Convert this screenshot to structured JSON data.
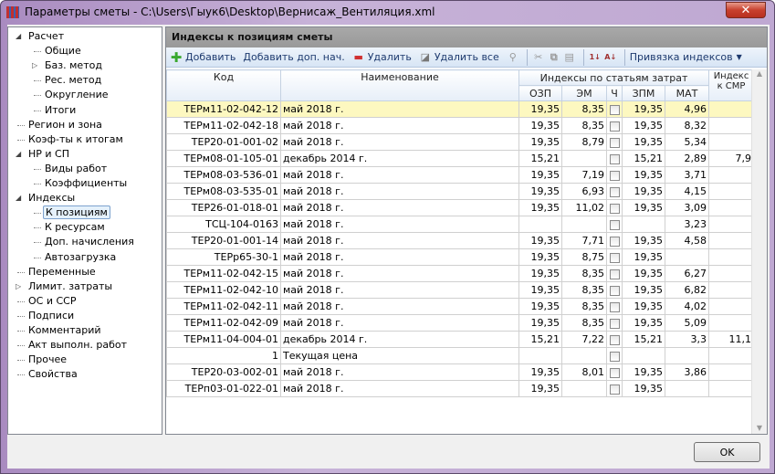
{
  "window": {
    "title": "Параметры сметы - C:\\Users\\Гыук6\\Desktop\\Вернисаж_Вентиляция.xml",
    "close": "✕"
  },
  "tree": [
    {
      "label": "Расчет",
      "level": 0,
      "expander": "expanded"
    },
    {
      "label": "Общие",
      "level": 1
    },
    {
      "label": "Баз. метод",
      "level": 1,
      "expander": "collapsed"
    },
    {
      "label": "Рес. метод",
      "level": 1
    },
    {
      "label": "Округление",
      "level": 1
    },
    {
      "label": "Итоги",
      "level": 1
    },
    {
      "label": "Регион и зона",
      "level": 0
    },
    {
      "label": "Коэф-ты к итогам",
      "level": 0
    },
    {
      "label": "НР и СП",
      "level": 0,
      "expander": "expanded"
    },
    {
      "label": "Виды работ",
      "level": 1
    },
    {
      "label": "Коэффициенты",
      "level": 1
    },
    {
      "label": "Индексы",
      "level": 0,
      "expander": "expanded"
    },
    {
      "label": "К позициям",
      "level": 1,
      "selected": true
    },
    {
      "label": "К ресурсам",
      "level": 1
    },
    {
      "label": "Доп. начисления",
      "level": 1
    },
    {
      "label": "Автозагрузка",
      "level": 1
    },
    {
      "label": "Переменные",
      "level": 0
    },
    {
      "label": "Лимит. затраты",
      "level": 0,
      "expander": "collapsed"
    },
    {
      "label": "ОС и ССР",
      "level": 0
    },
    {
      "label": "Подписи",
      "level": 0
    },
    {
      "label": "Комментарий",
      "level": 0
    },
    {
      "label": "Акт выполн. работ",
      "level": 0
    },
    {
      "label": "Прочее",
      "level": 0
    },
    {
      "label": "Свойства",
      "level": 0
    }
  ],
  "panel": {
    "title": "Индексы к позициям сметы"
  },
  "toolbar": {
    "add": "Добавить",
    "add_extra": "Добавить доп. нач.",
    "delete": "Удалить",
    "delete_all": "Удалить все",
    "binding": "Привязка индексов"
  },
  "table": {
    "headers": {
      "code": "Код",
      "name": "Наименование",
      "group": "Индексы по статьям затрат",
      "ozp": "ОЗП",
      "em": "ЭМ",
      "ch": "Ч",
      "zpm": "ЗПМ",
      "mat": "МАТ",
      "smr": "Индекс к СМР"
    },
    "rows": [
      [
        "ТЕРм11-02-042-12",
        "май 2018 г.",
        "19,35",
        "8,35",
        "19,35",
        "4,96",
        ""
      ],
      [
        "ТЕРм11-02-042-18",
        "май 2018 г.",
        "19,35",
        "8,35",
        "19,35",
        "8,32",
        ""
      ],
      [
        "ТЕР20-01-001-02",
        "май 2018 г.",
        "19,35",
        "8,79",
        "19,35",
        "5,34",
        ""
      ],
      [
        "ТЕРм08-01-105-01",
        "декабрь 2014 г.",
        "15,21",
        "",
        "15,21",
        "2,89",
        "7,9"
      ],
      [
        "ТЕРм08-03-536-01",
        "май 2018 г.",
        "19,35",
        "7,19",
        "19,35",
        "3,71",
        ""
      ],
      [
        "ТЕРм08-03-535-01",
        "май 2018 г.",
        "19,35",
        "6,93",
        "19,35",
        "4,15",
        ""
      ],
      [
        "ТЕР26-01-018-01",
        "май 2018 г.",
        "19,35",
        "11,02",
        "19,35",
        "3,09",
        ""
      ],
      [
        "ТСЦ-104-0163",
        "май 2018 г.",
        "",
        "",
        "",
        "3,23",
        ""
      ],
      [
        "ТЕР20-01-001-14",
        "май 2018 г.",
        "19,35",
        "7,71",
        "19,35",
        "4,58",
        ""
      ],
      [
        "ТЕРр65-30-1",
        "май 2018 г.",
        "19,35",
        "8,75",
        "19,35",
        "",
        ""
      ],
      [
        "ТЕРм11-02-042-15",
        "май 2018 г.",
        "19,35",
        "8,35",
        "19,35",
        "6,27",
        ""
      ],
      [
        "ТЕРм11-02-042-10",
        "май 2018 г.",
        "19,35",
        "8,35",
        "19,35",
        "6,82",
        ""
      ],
      [
        "ТЕРм11-02-042-11",
        "май 2018 г.",
        "19,35",
        "8,35",
        "19,35",
        "4,02",
        ""
      ],
      [
        "ТЕРм11-02-042-09",
        "май 2018 г.",
        "19,35",
        "8,35",
        "19,35",
        "5,09",
        ""
      ],
      [
        "ТЕРм11-04-004-01",
        "декабрь 2014 г.",
        "15,21",
        "7,22",
        "15,21",
        "3,3",
        "11,1"
      ],
      [
        "1",
        "Текущая цена",
        "",
        "",
        "",
        "",
        ""
      ],
      [
        "ТЕР20-03-002-01",
        "май 2018 г.",
        "19,35",
        "8,01",
        "19,35",
        "3,86",
        ""
      ],
      [
        "ТЕРп03-01-022-01",
        "май 2018 г.",
        "19,35",
        "",
        "19,35",
        "",
        ""
      ]
    ]
  },
  "footer": {
    "ok": "OK"
  },
  "colors": {
    "selected_row": "#fdf8c0",
    "panel_header": "#a0a0a0",
    "toolbar_text": "#1e3a6e"
  }
}
